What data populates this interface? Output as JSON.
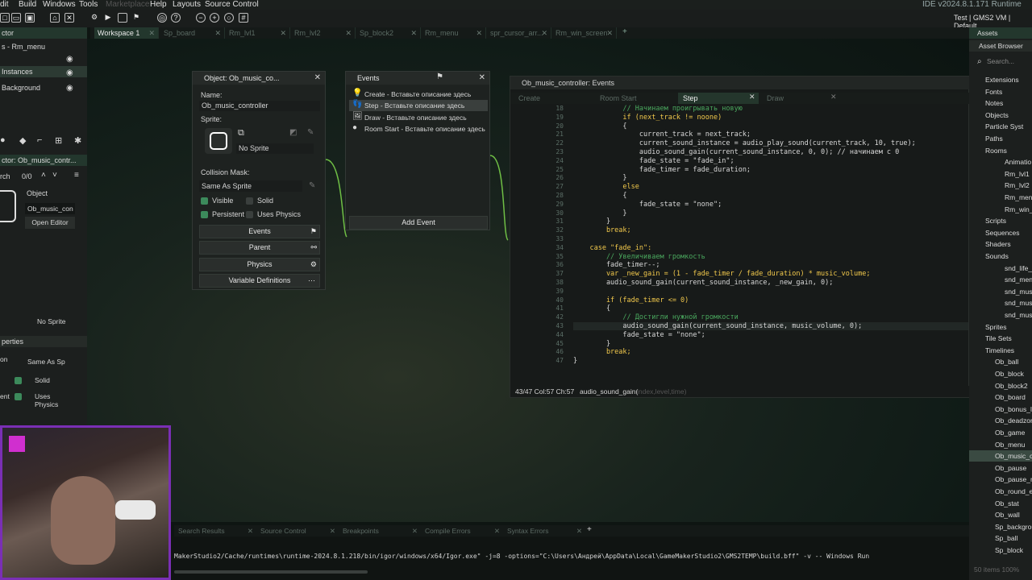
{
  "menubar": {
    "items": [
      "dit",
      "Build",
      "Windows",
      "Tools",
      "Marketplace",
      "Help",
      "Layouts",
      "Source Control"
    ],
    "ide_version": "IDE v2024.8.1.171  Runtime v2024.8",
    "target": "Test | GMS2 VM | Default"
  },
  "tabs": [
    {
      "label": "Workspace 1",
      "active": true
    },
    {
      "label": "Sp_board"
    },
    {
      "label": "Rm_lvl1"
    },
    {
      "label": "Rm_lvl2"
    },
    {
      "label": "Sp_block2"
    },
    {
      "label": "Rm_menu"
    },
    {
      "label": "spr_cursor_arr..."
    },
    {
      "label": "Rm_win_screen"
    }
  ],
  "left_panel": {
    "top_title": "ctor",
    "room_label": "s - Rm_menu",
    "layers": [
      "Instances",
      "Background"
    ],
    "inspector_title": "ctor: Ob_music_contr...",
    "search_label": "rch",
    "count": "0/0",
    "object_header": "Object",
    "object_name": "Ob_music_con",
    "open_editor": "Open Editor",
    "no_sprite": "No Sprite",
    "properties_label": "perties",
    "mask_label": "on",
    "mask_value": "Same As Sp",
    "solid_label": "Solid",
    "persist_label": "ent",
    "uses_physics_label": "Uses Physics"
  },
  "object_window": {
    "title": "Object: Ob_music_co...",
    "name_label": "Name:",
    "name_value": "Ob_music_controller",
    "sprite_label": "Sprite:",
    "sprite_value": "No Sprite",
    "collision_label": "Collision Mask:",
    "collision_value": "Same As Sprite",
    "visible_label": "Visible",
    "solid_label": "Solid",
    "persistent_label": "Persistent",
    "uses_physics_label": "Uses Physics",
    "buttons": [
      "Events",
      "Parent",
      "Physics",
      "Variable Definitions"
    ]
  },
  "events_window": {
    "title": "Events",
    "items": [
      "Create - Вставьте описание здесь",
      "Step - Вставьте описание здесь",
      "Draw - Вставьте описание здесь",
      "Room Start - Вставьте описание здесь"
    ],
    "add_event": "Add Event"
  },
  "code_window": {
    "title": "Ob_music_controller: Events",
    "tabs": [
      "Create",
      "Room Start",
      "Step",
      "Draw"
    ],
    "active_tab": "Step",
    "line_numbers": [
      "18",
      "19",
      "20",
      "21",
      "22",
      "23",
      "24",
      "25",
      "26",
      "27",
      "28",
      "29",
      "30",
      "31",
      "32",
      "33",
      "34",
      "35",
      "36",
      "37",
      "38",
      "39",
      "40",
      "41",
      "42",
      "43",
      "44",
      "45",
      "46",
      "47"
    ],
    "lines": [
      "            // Начинаем проигрывать новую",
      "            if (next_track != noone)",
      "            {",
      "                current_track = next_track;",
      "                current_sound_instance = audio_play_sound(current_track, 10, true);",
      "                audio_sound_gain(current_sound_instance, 0, 0); // начинаем с 0",
      "                fade_state = \"fade_in\";",
      "                fade_timer = fade_duration;",
      "            }",
      "            else",
      "            {",
      "                fade_state = \"none\";",
      "            }",
      "        }",
      "        break;",
      "",
      "    case \"fade_in\":",
      "        // Увеличиваем громкость",
      "        fade_timer--;",
      "        var _new_gain = (1 - fade_timer / fade_duration) * music_volume;",
      "        audio_sound_gain(current_sound_instance, _new_gain, 0);",
      "",
      "        if (fade_timer <= 0)",
      "        {",
      "            // Достигли нужной громкости",
      "            audio_sound_gain(current_sound_instance, music_volume, 0);",
      "            fade_state = \"none\";",
      "        }",
      "        break;",
      "}"
    ],
    "status_pos": "43/47 Col:57 Ch:57",
    "status_hint": "audio_sound_gain(",
    "status_hint_args": "index,level,time)"
  },
  "assets": {
    "header": "Assets",
    "browser": "Asset Browser",
    "search_placeholder": "Search...",
    "items": [
      "Extensions",
      "Fonts",
      "Notes",
      "Objects",
      "Particle Syst",
      "Paths",
      "Rooms",
      "Animatio",
      "Rm_lvl1",
      "Rm_lvl2",
      "Rm_men",
      "Rm_win_s",
      "Scripts",
      "Sequences",
      "Shaders",
      "Sounds",
      "snd_life_",
      "snd_men",
      "snd_mus",
      "snd_mus",
      "snd_mus",
      "Sprites",
      "Tile Sets",
      "Timelines",
      "Ob_ball",
      "Ob_block",
      "Ob_block2",
      "Ob_board",
      "Ob_bonus_l",
      "Ob_deadzor",
      "Ob_game",
      "Ob_menu",
      "Ob_music_c",
      "Ob_pause",
      "Ob_pause_m",
      "Ob_round_e",
      "Ob_stat",
      "Ob_wall",
      "Sp_backgrou",
      "Sp_ball",
      "Sp_block"
    ],
    "footer": "50 items  100%"
  },
  "bottom_tabs": [
    "Search Results",
    "Source Control",
    "Breakpoints",
    "Compile Errors",
    "Syntax Errors"
  ],
  "output_line": "MakerStudio2/Cache/runtimes\\runtime-2024.8.1.218/bin/igor/windows/x64/Igor.exe\"  -j=8  -options=\"C:\\Users\\Андрей\\AppData\\Local\\GameMakerStudio2\\GMS2TEMP\\build.bff\" -v -- Windows Run",
  "colors": {
    "accent": "#3c8a5b",
    "active_tab": "#23372d",
    "webcam_border": "#7a2fb5"
  }
}
